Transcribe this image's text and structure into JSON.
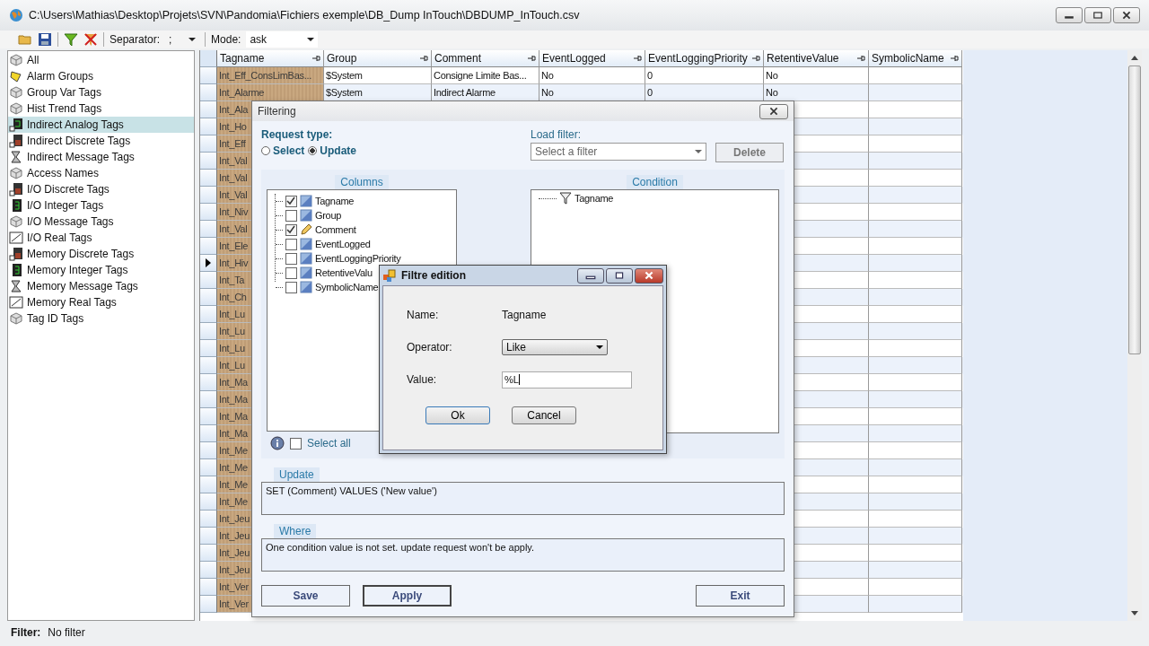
{
  "window": {
    "title": "C:\\Users\\Mathias\\Desktop\\Projets\\SVN\\Pandomia\\Fichiers exemple\\DB_Dump InTouch\\DBDUMP_InTouch.csv"
  },
  "toolbar": {
    "separator_label": "Separator:",
    "separator_value": ";",
    "mode_label": "Mode:",
    "mode_value": "ask"
  },
  "sidebar": {
    "items": [
      {
        "label": "All",
        "kind": "cube",
        "selected": false
      },
      {
        "label": "Alarm Groups",
        "kind": "bell",
        "selected": false
      },
      {
        "label": "Group Var Tags",
        "kind": "cube",
        "selected": false
      },
      {
        "label": "Hist Trend Tags",
        "kind": "cube",
        "selected": false
      },
      {
        "label": "Indirect Analog Tags",
        "kind": "analog",
        "selected": true
      },
      {
        "label": "Indirect Discrete Tags",
        "kind": "discrete",
        "selected": false
      },
      {
        "label": "Indirect Message Tags",
        "kind": "message",
        "selected": false
      },
      {
        "label": "Access Names",
        "kind": "cube",
        "selected": false
      },
      {
        "label": "I/O Discrete Tags",
        "kind": "discrete",
        "selected": false
      },
      {
        "label": "I/O Integer Tags",
        "kind": "integer",
        "selected": false
      },
      {
        "label": "I/O Message Tags",
        "kind": "cube",
        "selected": false
      },
      {
        "label": "I/O Real Tags",
        "kind": "real",
        "selected": false
      },
      {
        "label": "Memory Discrete Tags",
        "kind": "discrete",
        "selected": false
      },
      {
        "label": "Memory Integer Tags",
        "kind": "integer",
        "selected": false
      },
      {
        "label": "Memory Message Tags",
        "kind": "message",
        "selected": false
      },
      {
        "label": "Memory Real Tags",
        "kind": "real",
        "selected": false
      },
      {
        "label": "Tag ID Tags",
        "kind": "cube",
        "selected": false
      }
    ]
  },
  "table": {
    "columns": [
      "Tagname",
      "Group",
      "Comment",
      "EventLogged",
      "EventLoggingPriority",
      "RetentiveValue",
      "SymbolicName"
    ],
    "rows": [
      {
        "cells": [
          "Int_Eff_ConsLimBas...",
          "$System",
          "Consigne Limite Bas...",
          "No",
          "0",
          "No"
        ],
        "selected": false
      },
      {
        "cells": [
          "Int_Alarme",
          "$System",
          "Indirect Alarme",
          "No",
          "0",
          "No"
        ],
        "selected": false
      },
      {
        "cells": [
          "Int_Ala"
        ],
        "selected": false
      },
      {
        "cells": [
          "Int_Ho"
        ],
        "selected": false
      },
      {
        "cells": [
          "Int_Eff"
        ],
        "selected": false
      },
      {
        "cells": [
          "Int_Val"
        ],
        "selected": false
      },
      {
        "cells": [
          "Int_Val"
        ],
        "selected": false
      },
      {
        "cells": [
          "Int_Val"
        ],
        "selected": false
      },
      {
        "cells": [
          "Int_Niv"
        ],
        "selected": false
      },
      {
        "cells": [
          "Int_Val"
        ],
        "selected": false
      },
      {
        "cells": [
          "Int_Ele"
        ],
        "selected": false
      },
      {
        "cells": [
          "Int_Hiv"
        ],
        "selected": true
      },
      {
        "cells": [
          "Int_Ta"
        ],
        "selected": false
      },
      {
        "cells": [
          "Int_Ch"
        ],
        "selected": false
      },
      {
        "cells": [
          "Int_Lu"
        ],
        "selected": false
      },
      {
        "cells": [
          "Int_Lu"
        ],
        "selected": false
      },
      {
        "cells": [
          "Int_Lu"
        ],
        "selected": false
      },
      {
        "cells": [
          "Int_Lu"
        ],
        "selected": false
      },
      {
        "cells": [
          "Int_Ma"
        ],
        "selected": false
      },
      {
        "cells": [
          "Int_Ma"
        ],
        "selected": false
      },
      {
        "cells": [
          "Int_Ma"
        ],
        "selected": false
      },
      {
        "cells": [
          "Int_Ma"
        ],
        "selected": false
      },
      {
        "cells": [
          "Int_Me"
        ],
        "selected": false
      },
      {
        "cells": [
          "Int_Me"
        ],
        "selected": false
      },
      {
        "cells": [
          "Int_Me"
        ],
        "selected": false
      },
      {
        "cells": [
          "Int_Me"
        ],
        "selected": false
      },
      {
        "cells": [
          "Int_Jeu"
        ],
        "selected": false
      },
      {
        "cells": [
          "Int_Jeu"
        ],
        "selected": false
      },
      {
        "cells": [
          "Int_Jeu"
        ],
        "selected": false
      },
      {
        "cells": [
          "Int_Jeu"
        ],
        "selected": false
      },
      {
        "cells": [
          "Int_Ver"
        ],
        "selected": false
      },
      {
        "cells": [
          "Int_Ver"
        ],
        "selected": false
      }
    ]
  },
  "status_bar": {
    "label": "Filter:",
    "value": "No filter"
  },
  "filtering_dialog": {
    "title": "Filtering",
    "request_type_label": "Request type:",
    "request_types": [
      {
        "label": "Select",
        "selected": false
      },
      {
        "label": "Update",
        "selected": true
      }
    ],
    "load_filter_label": "Load filter:",
    "load_filter_placeholder": "Select a filter",
    "delete_button": "Delete",
    "columns_title": "Columns",
    "columns": [
      {
        "label": "Tagname",
        "checked": true,
        "kind": "column"
      },
      {
        "label": "Group",
        "checked": false,
        "kind": "column"
      },
      {
        "label": "Comment",
        "checked": true,
        "kind": "edited"
      },
      {
        "label": "EventLogged",
        "checked": false,
        "kind": "column"
      },
      {
        "label": "EventLoggingPriority",
        "checked": false,
        "kind": "column"
      },
      {
        "label": "RetentiveValu",
        "checked": false,
        "kind": "column"
      },
      {
        "label": "SymbolicName",
        "checked": false,
        "kind": "column"
      }
    ],
    "condition_title": "Condition",
    "conditions": [
      "Tagname"
    ],
    "select_all": {
      "label": "Select all",
      "checked": false
    },
    "update_label": "Update",
    "update_text": "SET (Comment) VALUES ('New value')",
    "where_label": "Where",
    "where_text": "One condition value is not set. update request won't be apply.",
    "buttons": [
      "Save",
      "Apply",
      "Exit"
    ]
  },
  "filtre_edition": {
    "title": "Filtre edition",
    "name_label": "Name:",
    "name_value": "Tagname",
    "operator_label": "Operator:",
    "operator_value": "Like",
    "value_label": "Value:",
    "value": "%L",
    "buttons": [
      "Ok",
      "Cancel"
    ]
  }
}
